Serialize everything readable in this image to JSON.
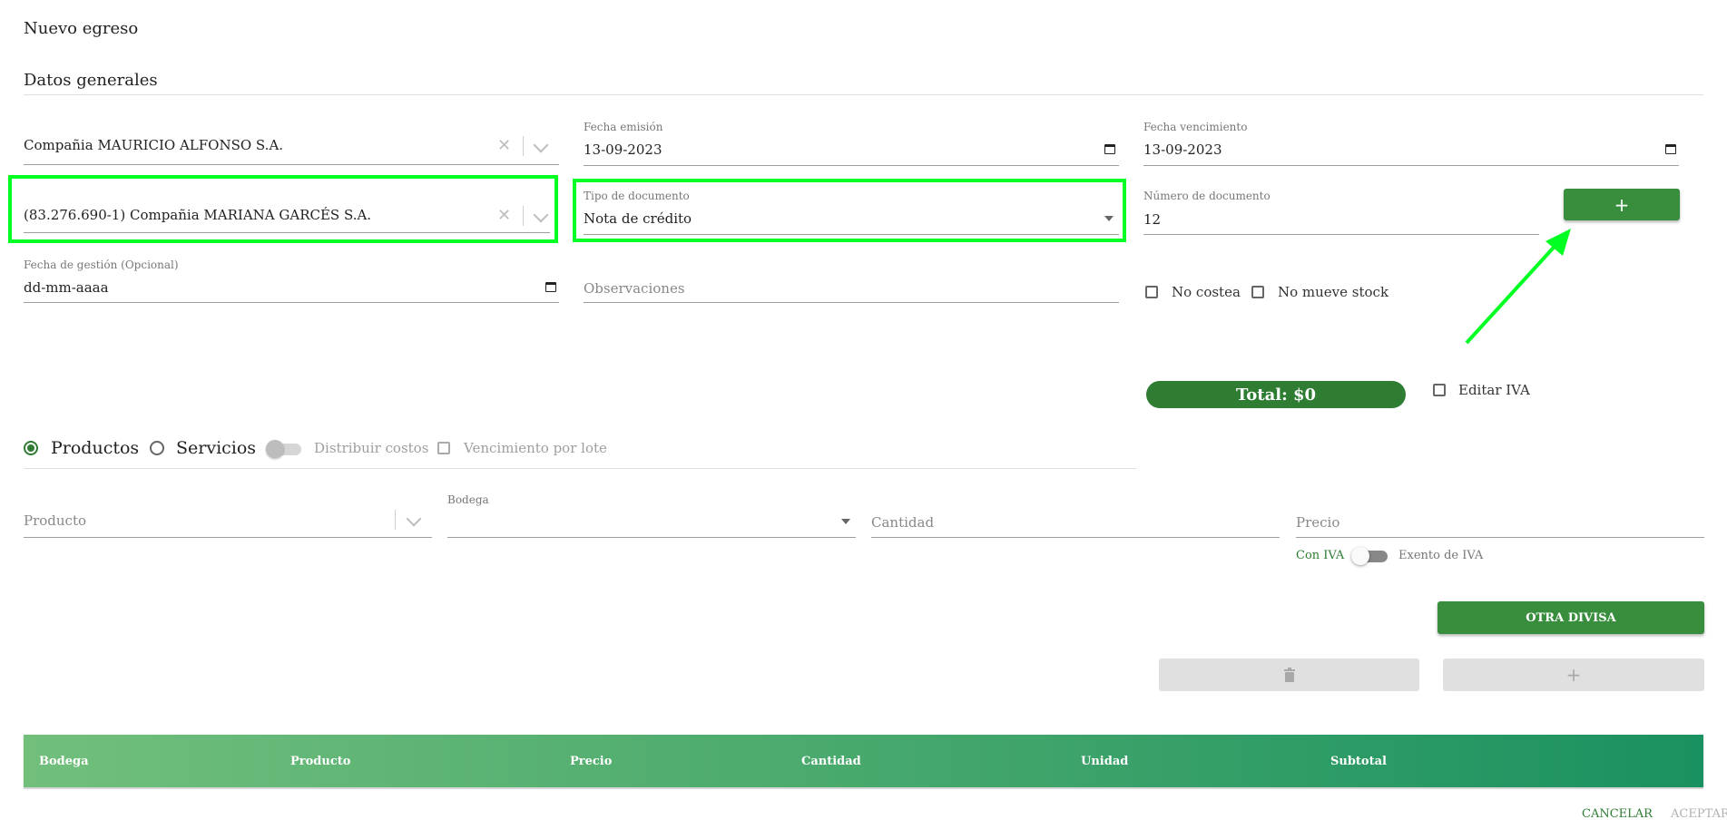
{
  "page": {
    "title": "Nuevo egreso",
    "section_title": "Datos generales"
  },
  "fields": {
    "company": {
      "value": "Compañia MAURICIO ALFONSO S.A."
    },
    "fecha_emision": {
      "label": "Fecha emisión",
      "value": "13-09-2023"
    },
    "fecha_vencimiento": {
      "label": "Fecha vencimiento",
      "value": "13-09-2023"
    },
    "proveedor": {
      "value": "(83.276.690-1) Compañia MARIANA GARCÉS S.A."
    },
    "tipo_documento": {
      "label": "Tipo de documento",
      "value": "Nota de crédito"
    },
    "numero_documento": {
      "label": "Número de documento",
      "value": "12"
    },
    "fecha_gestion": {
      "label": "Fecha de gestión (Opcional)",
      "value": "dd-mm-aaaa"
    },
    "observaciones": {
      "placeholder": "Observaciones"
    }
  },
  "checkboxes": {
    "no_costea": "No costea",
    "no_mueve_stock": "No mueve stock",
    "editar_iva": "Editar IVA",
    "vencimiento_por_lote": "Vencimiento por lote"
  },
  "total": {
    "label": "Total: $0"
  },
  "item_type": {
    "productos": "Productos",
    "servicios": "Servicios",
    "selected": "Productos",
    "distribuir_costos": "Distribuir costos"
  },
  "item_entry": {
    "producto_placeholder": "Producto",
    "bodega_label": "Bodega",
    "cantidad_placeholder": "Cantidad",
    "precio_placeholder": "Precio",
    "con_iva": "Con IVA",
    "exento_iva": "Exento de IVA"
  },
  "buttons": {
    "add_number": "+",
    "otra_divisa": "OTRA DIVISA",
    "add_item": "+",
    "cancelar": "CANCELAR",
    "aceptar": "ACEPTAR"
  },
  "table": {
    "columns": [
      "Bodega",
      "Producto",
      "Precio",
      "Cantidad",
      "Unidad",
      "Subtotal"
    ]
  },
  "colors": {
    "primary_green": "#388e3c",
    "highlight": "#00ff22",
    "header_gradient_start": "#72bf7c",
    "header_gradient_end": "#1a9160"
  },
  "icons": {
    "date_picker": "calendar-icon",
    "delete": "trash-icon",
    "clear": "clear-icon",
    "dropdown": "chevron-down-icon"
  }
}
